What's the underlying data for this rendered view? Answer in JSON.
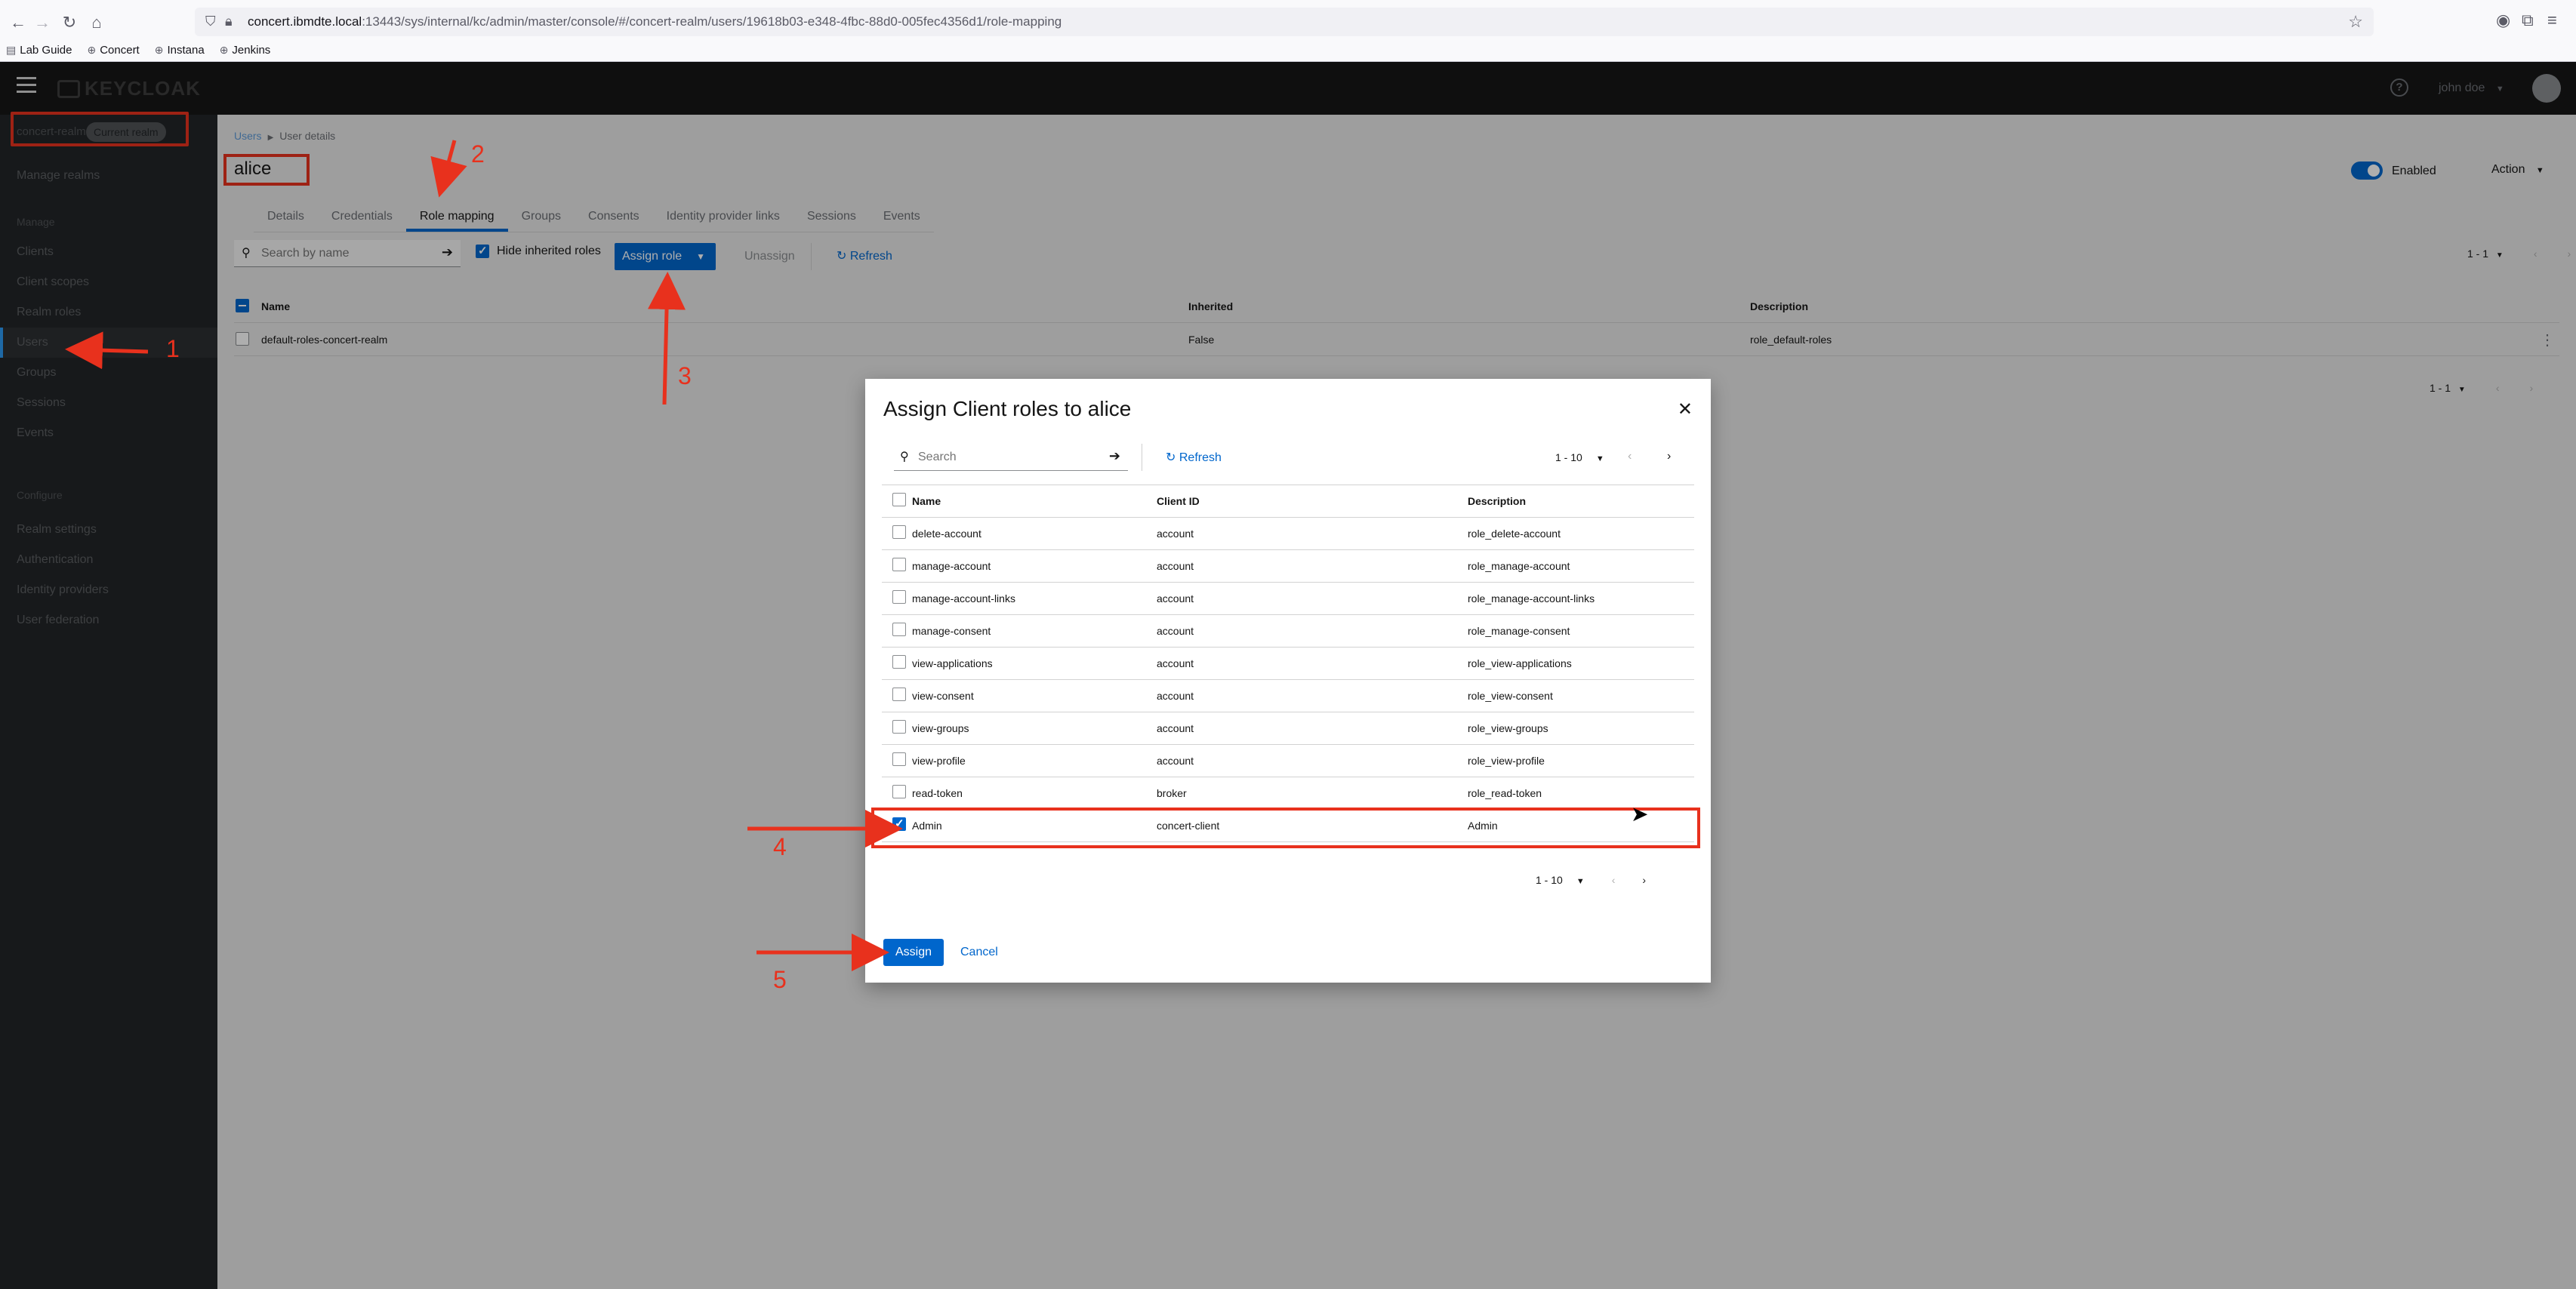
{
  "browser": {
    "url_host": "concert.ibmdte.local",
    "url_rest": ":13443/sys/internal/kc/admin/master/console/#/concert-realm/users/19618b03-e348-4fbc-88d0-005fec4356d1/role-mapping",
    "bookmarks": [
      "Lab Guide",
      "Concert",
      "Instana",
      "Jenkins"
    ]
  },
  "header": {
    "logo": "KEYCLOAK",
    "help": "?",
    "user": "john doe"
  },
  "sidebar": {
    "realm": "concert-realm",
    "realm_badge": "Current realm",
    "manage_realms": "Manage realms",
    "section_manage": "Manage",
    "manage_items": [
      "Clients",
      "Client scopes",
      "Realm roles",
      "Users",
      "Groups",
      "Sessions",
      "Events"
    ],
    "section_configure": "Configure",
    "configure_items": [
      "Realm settings",
      "Authentication",
      "Identity providers",
      "User federation"
    ],
    "active_item": "Users"
  },
  "page": {
    "breadcrumb": [
      "Users",
      "User details"
    ],
    "title": "alice",
    "enabled_label": "Enabled",
    "action_label": "Action",
    "tabs": [
      "Details",
      "Credentials",
      "Role mapping",
      "Groups",
      "Consents",
      "Identity provider links",
      "Sessions",
      "Events"
    ],
    "active_tab": "Role mapping",
    "search_placeholder": "Search by name",
    "hide_inherited": "Hide inherited roles",
    "assign_role": "Assign role",
    "unassign": "Unassign",
    "refresh": "Refresh",
    "pager": "1 - 1",
    "table": {
      "headers": [
        "Name",
        "Inherited",
        "Description"
      ],
      "rows": [
        [
          "default-roles-concert-realm",
          "False",
          "role_default-roles"
        ]
      ]
    }
  },
  "modal": {
    "title": "Assign Client roles to alice",
    "search_placeholder": "Search",
    "refresh": "Refresh",
    "pager": "1 - 10",
    "headers": [
      "Name",
      "Client ID",
      "Description"
    ],
    "rows": [
      {
        "name": "delete-account",
        "client": "account",
        "desc": "role_delete-account",
        "checked": false
      },
      {
        "name": "manage-account",
        "client": "account",
        "desc": "role_manage-account",
        "checked": false
      },
      {
        "name": "manage-account-links",
        "client": "account",
        "desc": "role_manage-account-links",
        "checked": false
      },
      {
        "name": "manage-consent",
        "client": "account",
        "desc": "role_manage-consent",
        "checked": false
      },
      {
        "name": "view-applications",
        "client": "account",
        "desc": "role_view-applications",
        "checked": false
      },
      {
        "name": "view-consent",
        "client": "account",
        "desc": "role_view-consent",
        "checked": false
      },
      {
        "name": "view-groups",
        "client": "account",
        "desc": "role_view-groups",
        "checked": false
      },
      {
        "name": "view-profile",
        "client": "account",
        "desc": "role_view-profile",
        "checked": false
      },
      {
        "name": "read-token",
        "client": "broker",
        "desc": "role_read-token",
        "checked": false
      },
      {
        "name": "Admin",
        "client": "concert-client",
        "desc": "Admin",
        "checked": true
      }
    ],
    "assign": "Assign",
    "cancel": "Cancel"
  },
  "annotations": {
    "steps": [
      "1",
      "2",
      "3",
      "4",
      "5"
    ],
    "color": "#e8311d"
  }
}
